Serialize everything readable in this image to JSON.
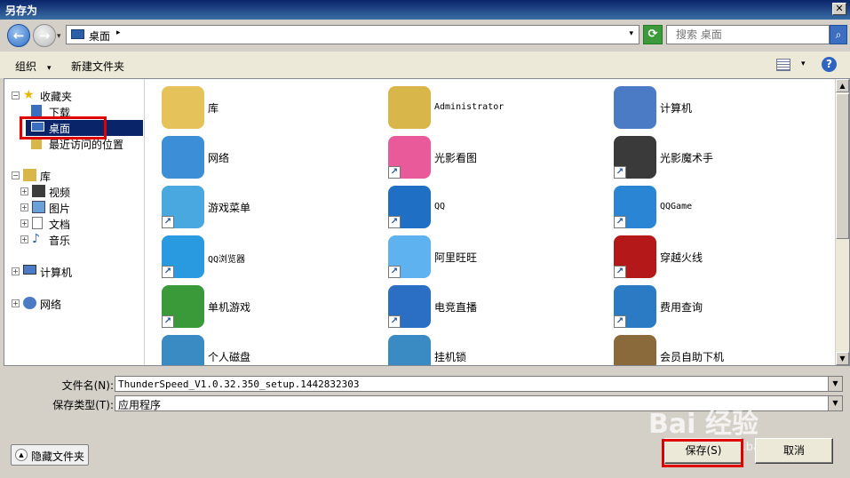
{
  "window": {
    "title": "另存为"
  },
  "address": {
    "location": "桌面",
    "search_placeholder": "搜索 桌面"
  },
  "toolbar": {
    "organize": "组织",
    "new_folder": "新建文件夹"
  },
  "nav": {
    "favorites": "收藏夹",
    "downloads": "下载",
    "desktop": "桌面",
    "recent": "最近访问的位置",
    "libraries": "库",
    "videos": "视频",
    "pictures": "图片",
    "documents": "文档",
    "music": "音乐",
    "computer": "计算机",
    "network": "网络"
  },
  "files": [
    {
      "name": "库",
      "icon": "library-icon",
      "shortcut": false
    },
    {
      "name": "Administrator",
      "icon": "user-folder-icon",
      "shortcut": false
    },
    {
      "name": "计算机",
      "icon": "computer-icon",
      "shortcut": false
    },
    {
      "name": "网络",
      "icon": "network-icon",
      "shortcut": false
    },
    {
      "name": "光影看图",
      "icon": "photo-viewer-icon",
      "shortcut": true
    },
    {
      "name": "光影魔术手",
      "icon": "photo-editor-icon",
      "shortcut": true
    },
    {
      "name": "游戏菜单",
      "icon": "game-menu-icon",
      "shortcut": true
    },
    {
      "name": "QQ",
      "icon": "qq-icon",
      "shortcut": true
    },
    {
      "name": "QQGame",
      "icon": "qqgame-icon",
      "shortcut": true
    },
    {
      "name": "QQ浏览器",
      "icon": "qq-browser-icon",
      "shortcut": true
    },
    {
      "name": "阿里旺旺",
      "icon": "aliwangwang-icon",
      "shortcut": true
    },
    {
      "name": "穿越火线",
      "icon": "crossfire-icon",
      "shortcut": true
    },
    {
      "name": "单机游戏",
      "icon": "joystick-icon",
      "shortcut": true
    },
    {
      "name": "电竞直播",
      "icon": "esports-icon",
      "shortcut": true
    },
    {
      "name": "费用查询",
      "icon": "info-icon",
      "shortcut": true
    },
    {
      "name": "个人磁盘",
      "icon": "personal-disk-icon",
      "shortcut": true
    },
    {
      "name": "挂机锁",
      "icon": "lock-icon",
      "shortcut": true
    },
    {
      "name": "会员自助下机",
      "icon": "signpost-icon",
      "shortcut": true
    }
  ],
  "form": {
    "filename_label": "文件名(N):",
    "filename_value": "ThunderSpeed_V1.0.32.350_setup.1442832303",
    "type_label": "保存类型(T):",
    "type_value": "应用程序"
  },
  "buttons": {
    "hide_folders": "隐藏文件夹",
    "save": "保存(S)",
    "cancel": "取消"
  },
  "watermark": {
    "text": "Bai 经验",
    "url": "jingyan.baidu.com"
  }
}
